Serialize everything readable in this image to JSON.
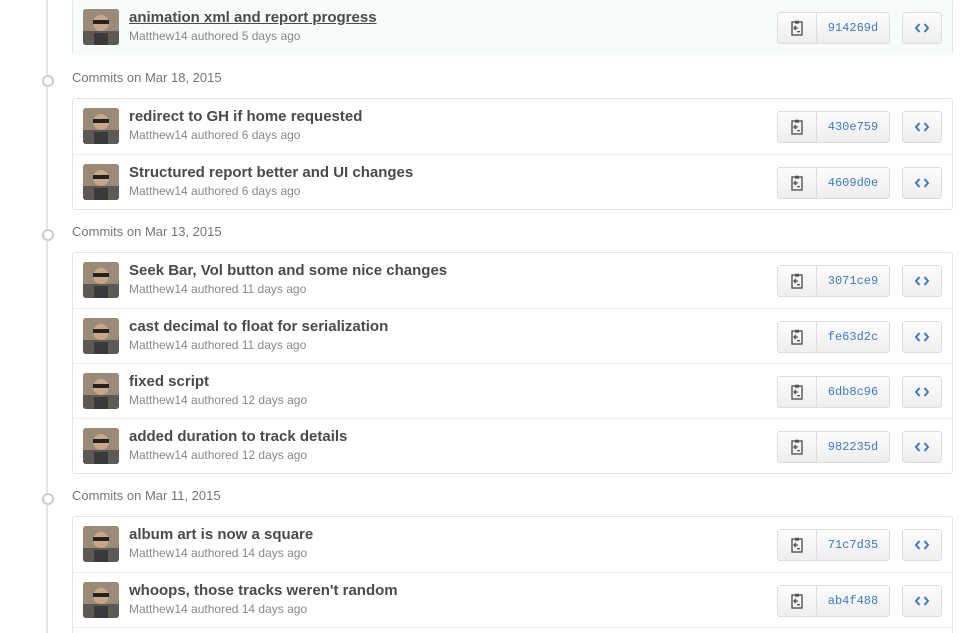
{
  "colors": {
    "link": "#4078c0",
    "title": "#4a4a4a",
    "meta": "#888888",
    "border": "#e5e5e5"
  },
  "icons": {
    "clipboard": "clippy-icon",
    "browse": "code-icon",
    "timeline": "commit-node-icon"
  },
  "top_commit": {
    "title": "animation xml and report progress",
    "author": "Matthew14",
    "authored": "authored 5 days ago",
    "sha": "914269d"
  },
  "groups": [
    {
      "title": "Commits on Mar 18, 2015",
      "commits": [
        {
          "title": "redirect to GH if home requested",
          "author": "Matthew14",
          "authored": "authored 6 days ago",
          "sha": "430e759"
        },
        {
          "title": "Structured report better and UI changes",
          "author": "Matthew14",
          "authored": "authored 6 days ago",
          "sha": "4609d0e"
        }
      ]
    },
    {
      "title": "Commits on Mar 13, 2015",
      "commits": [
        {
          "title": "Seek Bar, Vol button and some nice changes",
          "author": "Matthew14",
          "authored": "authored 11 days ago",
          "sha": "3071ce9"
        },
        {
          "title": "cast decimal to float for serialization",
          "author": "Matthew14",
          "authored": "authored 11 days ago",
          "sha": "fe63d2c"
        },
        {
          "title": "fixed script",
          "author": "Matthew14",
          "authored": "authored 12 days ago",
          "sha": "6db8c96"
        },
        {
          "title": "added duration to track details",
          "author": "Matthew14",
          "authored": "authored 12 days ago",
          "sha": "982235d"
        }
      ]
    },
    {
      "title": "Commits on Mar 11, 2015",
      "commits": [
        {
          "title": "album art is now a square",
          "author": "Matthew14",
          "authored": "authored 14 days ago",
          "sha": "71c7d35"
        },
        {
          "title": "whoops, those tracks weren't random",
          "author": "Matthew14",
          "authored": "authored 14 days ago",
          "sha": "ab4f488"
        }
      ]
    }
  ]
}
